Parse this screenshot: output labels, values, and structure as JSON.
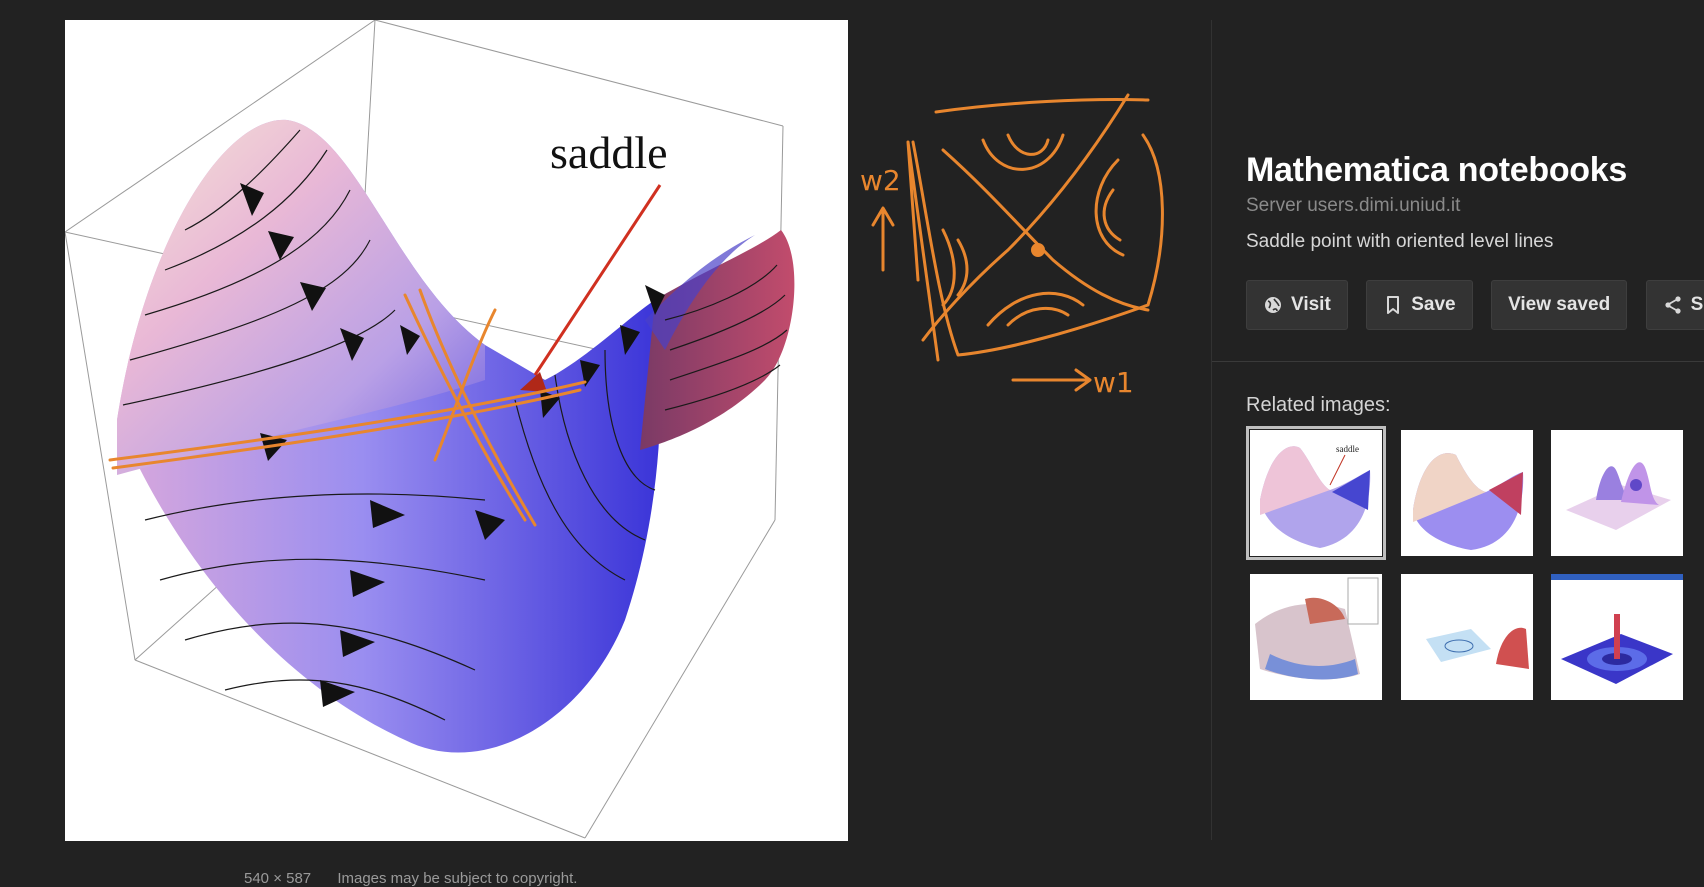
{
  "preview": {
    "label": "saddle",
    "size": "540 × 587",
    "notice": "Images may be subject to copyright."
  },
  "annotations": {
    "axis_x": "w1",
    "axis_y": "w2",
    "color": "#e8862e"
  },
  "panel": {
    "title": "Mathematica notebooks",
    "source": "Server users.dimi.uniud.it",
    "description": "Saddle point with oriented level lines",
    "buttons": [
      {
        "label": "Visit",
        "icon": "globe-icon"
      },
      {
        "label": "Save",
        "icon": "bookmark-icon"
      },
      {
        "label": "View saved"
      },
      {
        "label": "Share",
        "icon": "share-icon"
      }
    ],
    "related_label": "Related images:",
    "thumb_label": "saddle"
  },
  "colors": {
    "background": "#222222",
    "button_bg": "#333333",
    "annotation": "#e8862e"
  }
}
